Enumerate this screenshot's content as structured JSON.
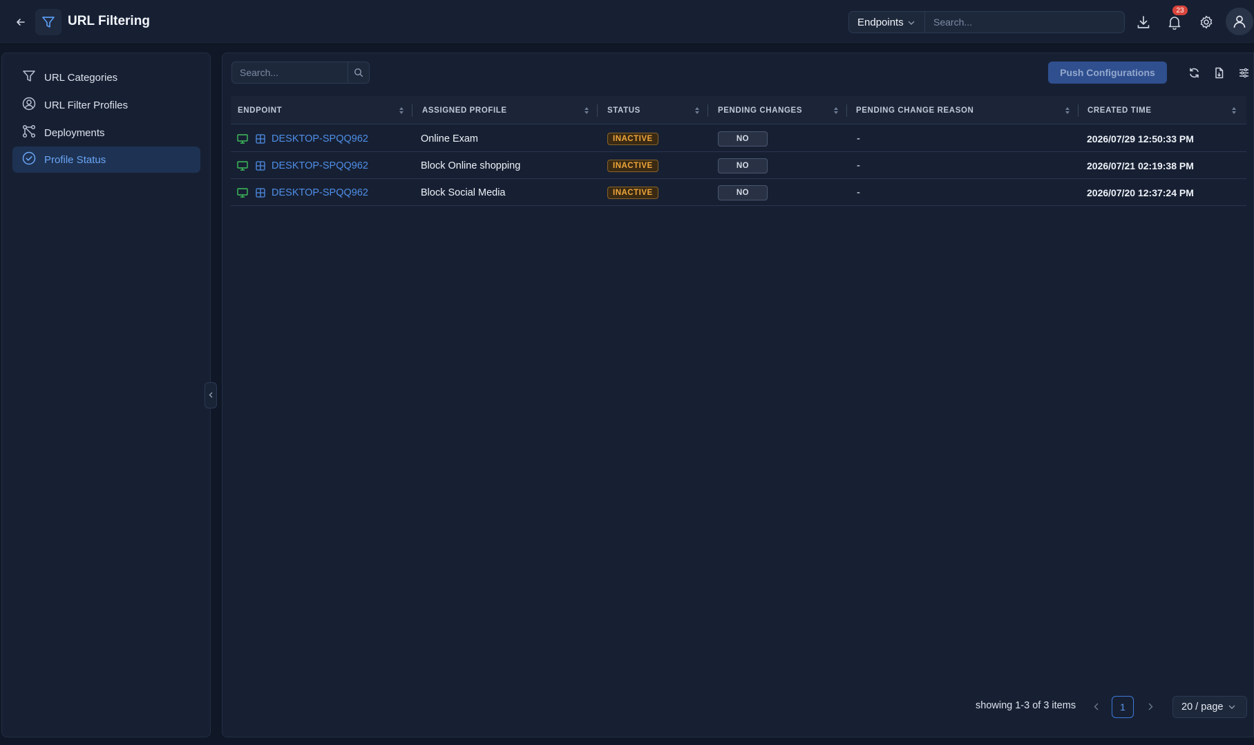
{
  "app": {
    "title": "URL Filtering",
    "scope_select": "Endpoints",
    "search_placeholder": "Search...",
    "notification_count": "23"
  },
  "sidebar": {
    "items": [
      {
        "label": "URL Categories",
        "icon": "filter-icon",
        "active": false
      },
      {
        "label": "URL Filter Profiles",
        "icon": "profile-icon",
        "active": false
      },
      {
        "label": "Deployments",
        "icon": "deployments-icon",
        "active": false
      },
      {
        "label": "Profile Status",
        "icon": "check-circle-icon",
        "active": true
      }
    ]
  },
  "main": {
    "search_placeholder": "Search...",
    "push_button": "Push Configurations",
    "columns": [
      "ENDPOINT",
      "ASSIGNED PROFILE",
      "STATUS",
      "PENDING CHANGES",
      "PENDING CHANGE REASON",
      "CREATED TIME"
    ],
    "rows": [
      {
        "endpoint": "DESKTOP-SPQQ962",
        "profile": "Online Exam",
        "status": "INACTIVE",
        "pending": "NO",
        "reason": "-",
        "created": "2026/07/29 12:50:33 PM"
      },
      {
        "endpoint": "DESKTOP-SPQQ962",
        "profile": "Block Online shopping",
        "status": "INACTIVE",
        "pending": "NO",
        "reason": "-",
        "created": "2026/07/21 02:19:38 PM"
      },
      {
        "endpoint": "DESKTOP-SPQQ962",
        "profile": "Block Social Media",
        "status": "INACTIVE",
        "pending": "NO",
        "reason": "-",
        "created": "2026/07/20 12:37:24 PM"
      }
    ],
    "pagination": {
      "summary": "showing 1-3 of 3 items",
      "current_page": "1",
      "page_size": "20 / page"
    }
  },
  "colors": {
    "background": "#101827",
    "panel": "#172033",
    "accent": "#4f8fe8",
    "status_inactive": "#f0a63a",
    "online_icon": "#3fbf5a"
  }
}
